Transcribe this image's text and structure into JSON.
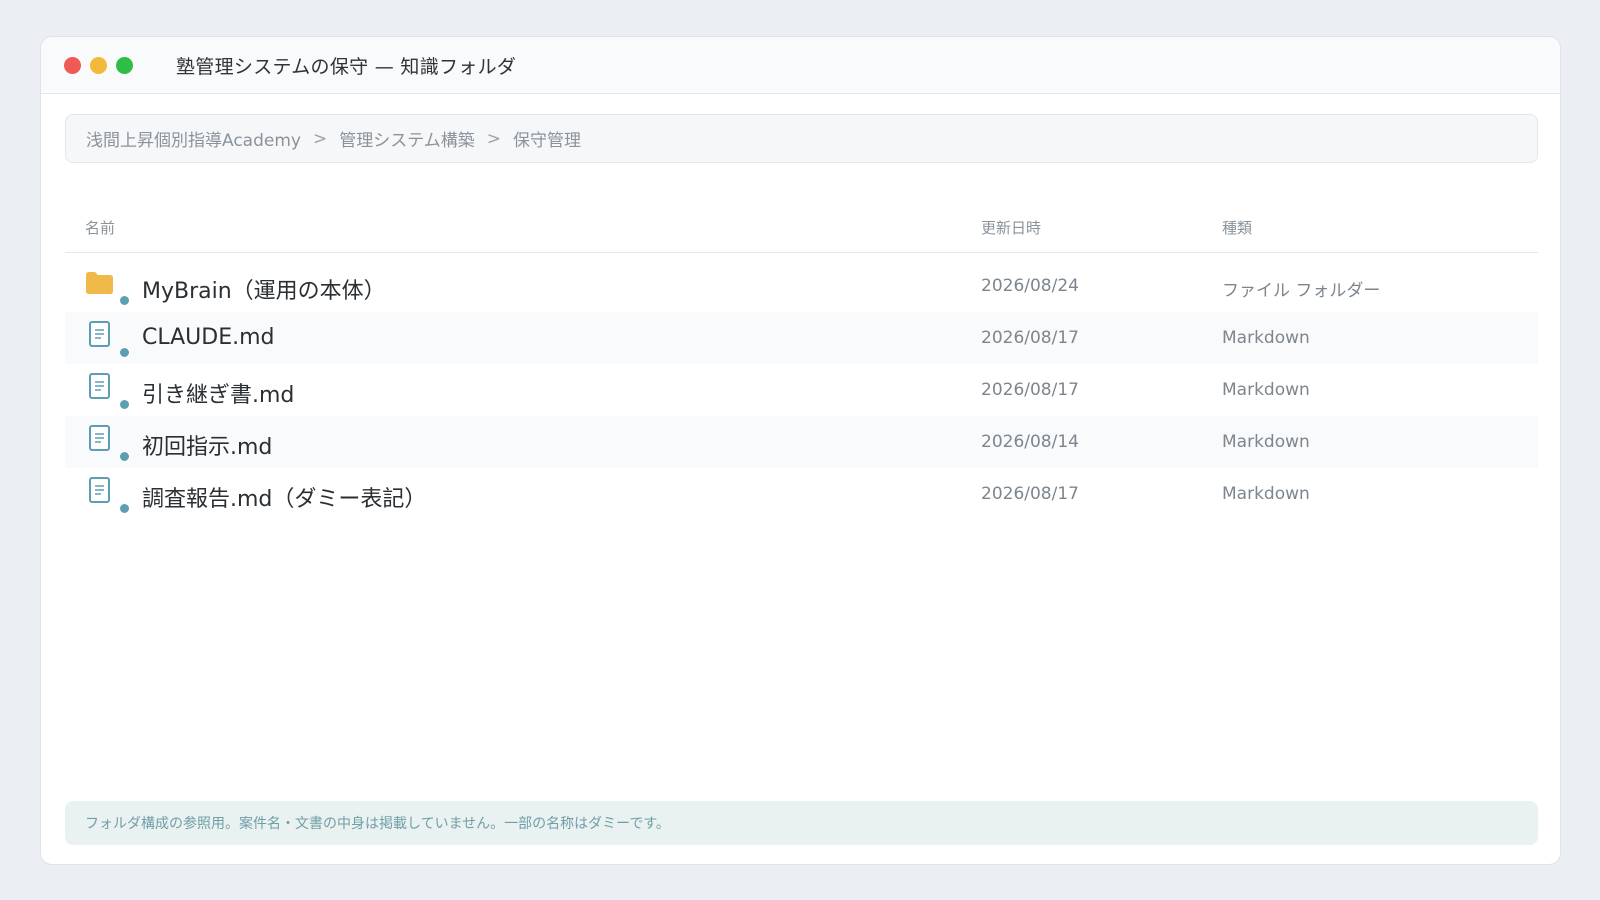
{
  "window": {
    "title": "塾管理システムの保守 — 知識フォルダ"
  },
  "breadcrumb": {
    "items": [
      "浅間上昇個別指導Academy",
      "管理システム構築",
      "保守管理"
    ],
    "separator": ">"
  },
  "table": {
    "columns": {
      "name": "名前",
      "date": "更新日時",
      "kind": "種類"
    },
    "rows": [
      {
        "name": "MyBrain（運用の本体）",
        "date": "2026/08/24",
        "kind": "ファイル フォルダー",
        "icon": "folder-icon"
      },
      {
        "name": "CLAUDE.md",
        "date": "2026/08/17",
        "kind": "Markdown",
        "icon": "document-icon"
      },
      {
        "name": "引き継ぎ書.md",
        "date": "2026/08/17",
        "kind": "Markdown",
        "icon": "document-icon"
      },
      {
        "name": "初回指示.md",
        "date": "2026/08/14",
        "kind": "Markdown",
        "icon": "document-icon"
      },
      {
        "name": "調査報告.md（ダミー表記）",
        "date": "2026/08/17",
        "kind": "Markdown",
        "icon": "document-icon"
      }
    ]
  },
  "footer": {
    "note": "フォルダ構成の参照用。案件名・文書の中身は掲載していません。一部の名称はダミーです。"
  },
  "colors": {
    "folder": "#f0b94a",
    "document": "#5c9fb3",
    "status_dot": "#5c9fb3",
    "close": "#f05a55",
    "minimize": "#f3b93a",
    "maximize": "#2fbe45"
  }
}
